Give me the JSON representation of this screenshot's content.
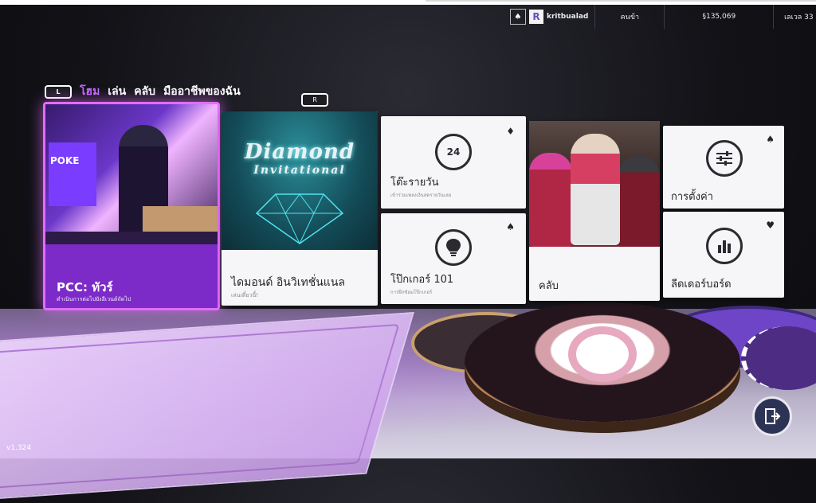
{
  "status": {
    "username": "kritbualad",
    "avatar_letter": "R",
    "spade_icon": "♠",
    "mode_label": "คนข้า",
    "currency": "§135,069",
    "level": "เลเวล 33"
  },
  "nav": {
    "left_bumper": "L",
    "right_bumper": "R",
    "tabs": [
      "โฮม",
      "เล่น",
      "คลับ",
      "มืออาชีพของฉัน"
    ],
    "active_tab": "โฮม"
  },
  "tiles": {
    "pcc": {
      "poster_text": "POKE",
      "title": "PCC: ทัวร์",
      "subtitle": "ดำเนินการต่อไปยังอีเวนต์ถัดไป"
    },
    "diamond": {
      "logo_line1": "Diamond",
      "logo_line2": "Invitational",
      "title": "ไดมอนด์ อินวิเทชั่นแนล",
      "subtitle": "เล่นเดี๋ยวนี้!"
    },
    "daily": {
      "icon_text": "24",
      "suit": "♦",
      "title": "โต๊ะรายวัน",
      "subtitle": "เข้าร่วมเพลงเงินสดรายวันเลย"
    },
    "poker101": {
      "icon": "💡",
      "suit": "♠",
      "title": "โป๊กเกอร์ 101",
      "subtitle": "การฝึกซ้อมโป๊กเกอร์"
    },
    "club": {
      "title": "คลับ"
    },
    "settings": {
      "icon": "☰",
      "suit": "♠",
      "title": "การตั้งค่า"
    },
    "leaders": {
      "icon": "▮",
      "suit": "♥",
      "title": "ลีดเดอร์บอร์ด"
    }
  },
  "exit_icon": "⍈",
  "version": "v1.324",
  "colors": {
    "accent": "#c26cff",
    "pcc_bg": "#7c2ac8",
    "tile_bg": "#f6f6f8"
  }
}
